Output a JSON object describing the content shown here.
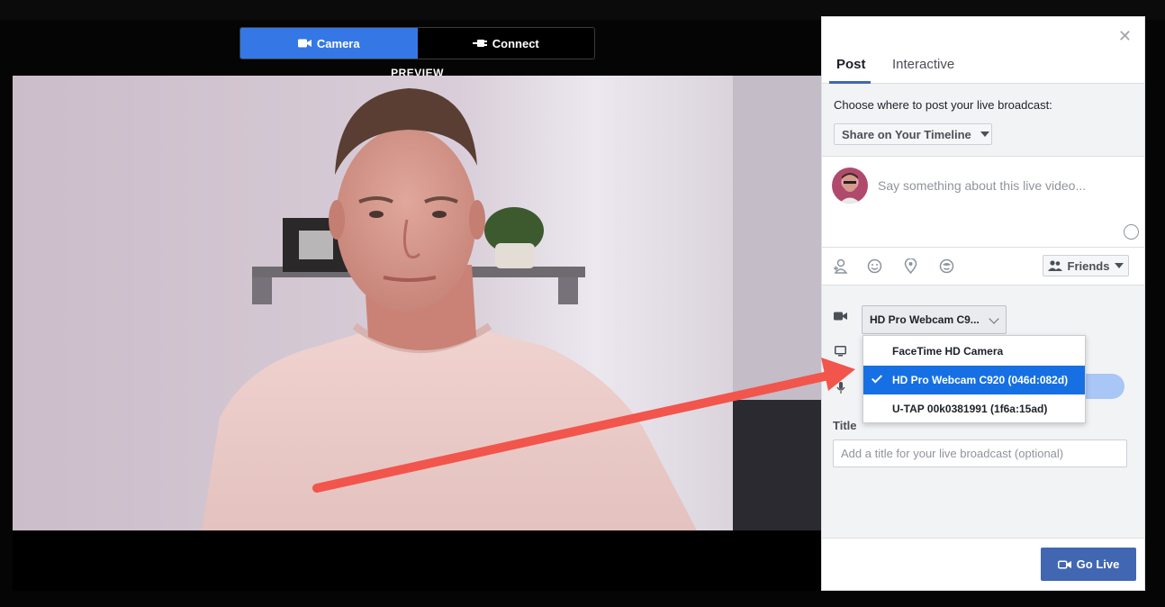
{
  "source_toggle": {
    "camera_label": "Camera",
    "connect_label": "Connect",
    "camera_icon": "video-camera-icon",
    "connect_icon": "plug-icon"
  },
  "preview_label": "PREVIEW",
  "panel": {
    "tabs": [
      {
        "label": "Post",
        "active": true
      },
      {
        "label": "Interactive",
        "active": false
      }
    ],
    "where_prompt": "Choose where to post your live broadcast:",
    "share_target": "Share on Your Timeline",
    "compose_placeholder": "Say something about this live video...",
    "audience_label": "Friends",
    "camera_select_value": "HD Pro Webcam C9...",
    "camera_options": [
      {
        "label": "FaceTime HD Camera",
        "selected": false
      },
      {
        "label": "HD Pro Webcam C920 (046d:082d)",
        "selected": true
      },
      {
        "label": "U-TAP 00k0381991 (1f6a:15ad)",
        "selected": false
      }
    ],
    "title_label": "Title",
    "title_placeholder": "Add a title for your live broadcast (optional)",
    "go_live_label": "Go Live"
  },
  "colors": {
    "accent_blue": "#3578e5",
    "fb_blue": "#4267b2",
    "dropdown_selected": "#1670e3",
    "annotation_arrow": "#f2554c"
  }
}
